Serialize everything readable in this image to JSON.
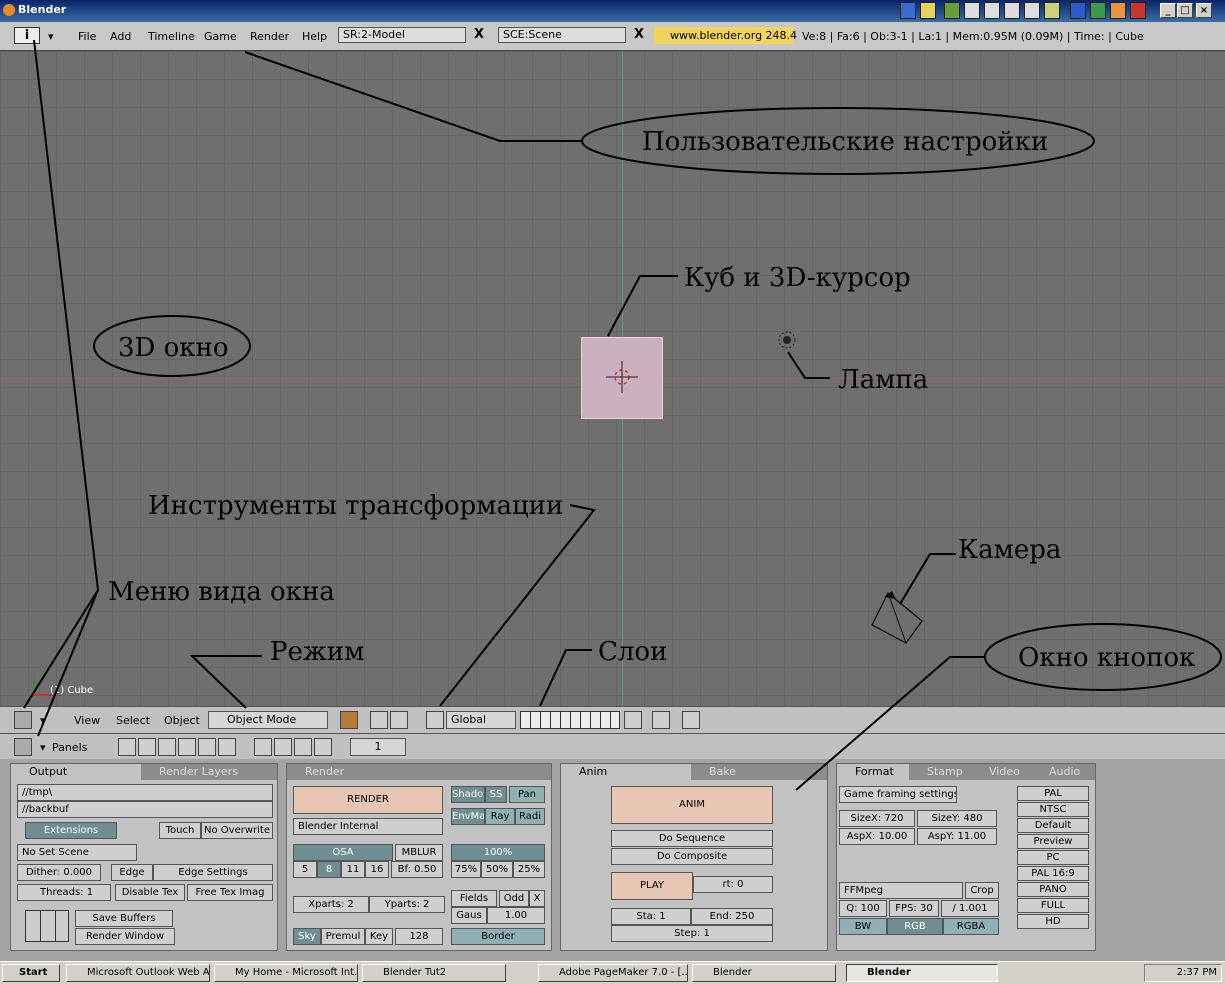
{
  "window": {
    "title": "Blender"
  },
  "info_header": {
    "menus": [
      "File",
      "Add",
      "Timeline",
      "Game",
      "Render",
      "Help"
    ],
    "screen": "SR:2-Model",
    "scene": "SCE:Scene",
    "site": "www.blender.org 248.4",
    "stats": "Ve:8 | Fa:6 | Ob:3-1 | La:1  | Mem:0.95M (0.09M)  | Time: | Cube"
  },
  "viewport": {
    "object_label": "(1) Cube"
  },
  "view_header": {
    "menus": [
      "View",
      "Select",
      "Object"
    ],
    "mode": "Object Mode",
    "orientation": "Global"
  },
  "buttons_header": {
    "panels_label": "Panels",
    "frame": "1"
  },
  "output_panel": {
    "tabs": [
      "Output",
      "Render Layers"
    ],
    "path1": "//tmp\\",
    "path2": "//backbuf",
    "extensions": "Extensions",
    "touch": "Touch",
    "no_overwrite": "No Overwrite",
    "no_set_scene": "No Set Scene",
    "dither": "Dither: 0.000",
    "edge": "Edge",
    "edge_settings": "Edge Settings",
    "threads": "Threads: 1",
    "disable_tex": "Disable Tex",
    "free_tex": "Free Tex Imag",
    "save_buffers": "Save Buffers",
    "render_window": "Render Window"
  },
  "render_panel": {
    "tab": "Render",
    "render": "RENDER",
    "renderer": "Blender Internal",
    "shadow": "Shadow",
    "ss": "SS",
    "pan": "Pan",
    "envmap": "EnvMap",
    "ray": "Ray",
    "radio": "Radi",
    "osa": "OSA",
    "mblur": "MBLUR",
    "pct100": "100%",
    "osa_vals": [
      "5",
      "8",
      "11",
      "16"
    ],
    "bf": "Bf: 0.50",
    "pcts": [
      "75%",
      "50%",
      "25%"
    ],
    "xparts": "Xparts: 2",
    "yparts": "Yparts: 2",
    "fields": "Fields",
    "odd": "Odd",
    "x": "X",
    "gauss": "Gaus",
    "gauss_val": "1.00",
    "sky": "Sky",
    "premul": "Premul",
    "key": "Key",
    "bits": "128",
    "border": "Border"
  },
  "anim_panel": {
    "tabs": [
      "Anim",
      "Bake"
    ],
    "anim": "ANIM",
    "do_sequence": "Do Sequence",
    "do_composite": "Do Composite",
    "play": "PLAY",
    "rt": "rt: 0",
    "sta": "Sta: 1",
    "end": "End: 250",
    "step": "Step: 1"
  },
  "format_panel": {
    "tabs": [
      "Format",
      "Stamp",
      "Video",
      "Audio"
    ],
    "game_framing": "Game framing settings",
    "sizex": "SizeX: 720",
    "sizey": "SizeY: 480",
    "aspx": "AspX: 10.00",
    "aspy": "AspY: 11.00",
    "codec": "FFMpeg",
    "crop": "Crop",
    "quality": "Q: 100",
    "fps": "FPS: 30",
    "fps_base": "/ 1.001",
    "bw": "BW",
    "rgb": "RGB",
    "rgba": "RGBA",
    "presets": [
      "PAL",
      "NTSC",
      "Default",
      "Preview",
      "PC",
      "PAL 16:9",
      "PANO",
      "FULL",
      "HD"
    ]
  },
  "annotations": {
    "user_prefs": "Пользовательские настройки",
    "cube_cursor": "Куб и 3D-курсор",
    "window_3d": "3D окно",
    "lamp": "Лампа",
    "transform_tools": "Инструменты трансформации",
    "camera": "Камера",
    "view_menu": "Меню вида окна",
    "mode": "Режим",
    "layers": "Слои",
    "buttons_window": "Окно кнопок"
  },
  "taskbar": {
    "start": "Start",
    "tasks": [
      "Microsoft Outlook Web A...",
      "My Home - Microsoft Int...",
      "Blender Tut2",
      "Adobe PageMaker 7.0 - [...",
      "Blender",
      "Blender"
    ],
    "clock": "2:37 PM"
  },
  "colors": {
    "viewport_bg": "#6f6f6f",
    "cube": "#cdb0bf",
    "x_axis": "#a86060",
    "y_axis": "#6a9a6a"
  }
}
